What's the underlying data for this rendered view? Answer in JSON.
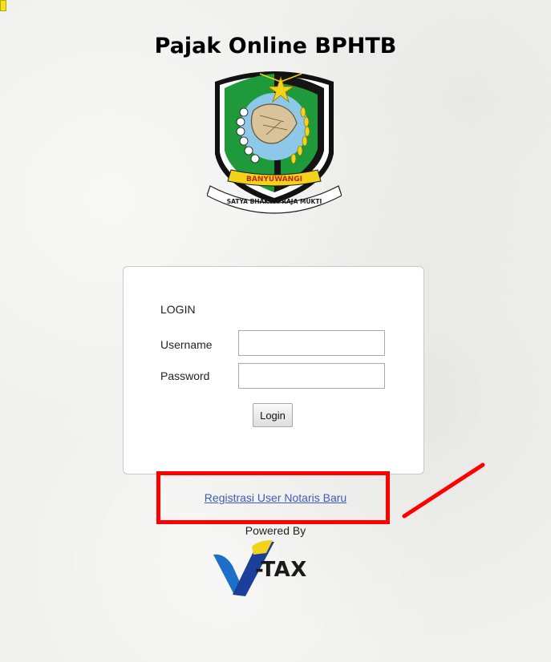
{
  "header": {
    "title": "Pajak Online BPHTB",
    "emblem": {
      "icon": "banyuwangi-emblem-icon",
      "banner_text": "BANYUWANGI",
      "motto_text": "SATYA BHAKTI PRAJA MUKTI"
    }
  },
  "login_form": {
    "heading": "LOGIN",
    "username_label": "Username",
    "username_value": "",
    "password_label": "Password",
    "password_value": "",
    "submit_label": "Login"
  },
  "footer": {
    "register_link": "Registrasi User Notaris Baru",
    "powered_by": "Powered By",
    "vendor_logo_text": "-TAX"
  },
  "annotations": {
    "highlight_color": "#ff0000"
  },
  "colors": {
    "link": "#3d5bb8",
    "emblem_green": "#1e9a3b",
    "emblem_yellow": "#f2d21a"
  }
}
